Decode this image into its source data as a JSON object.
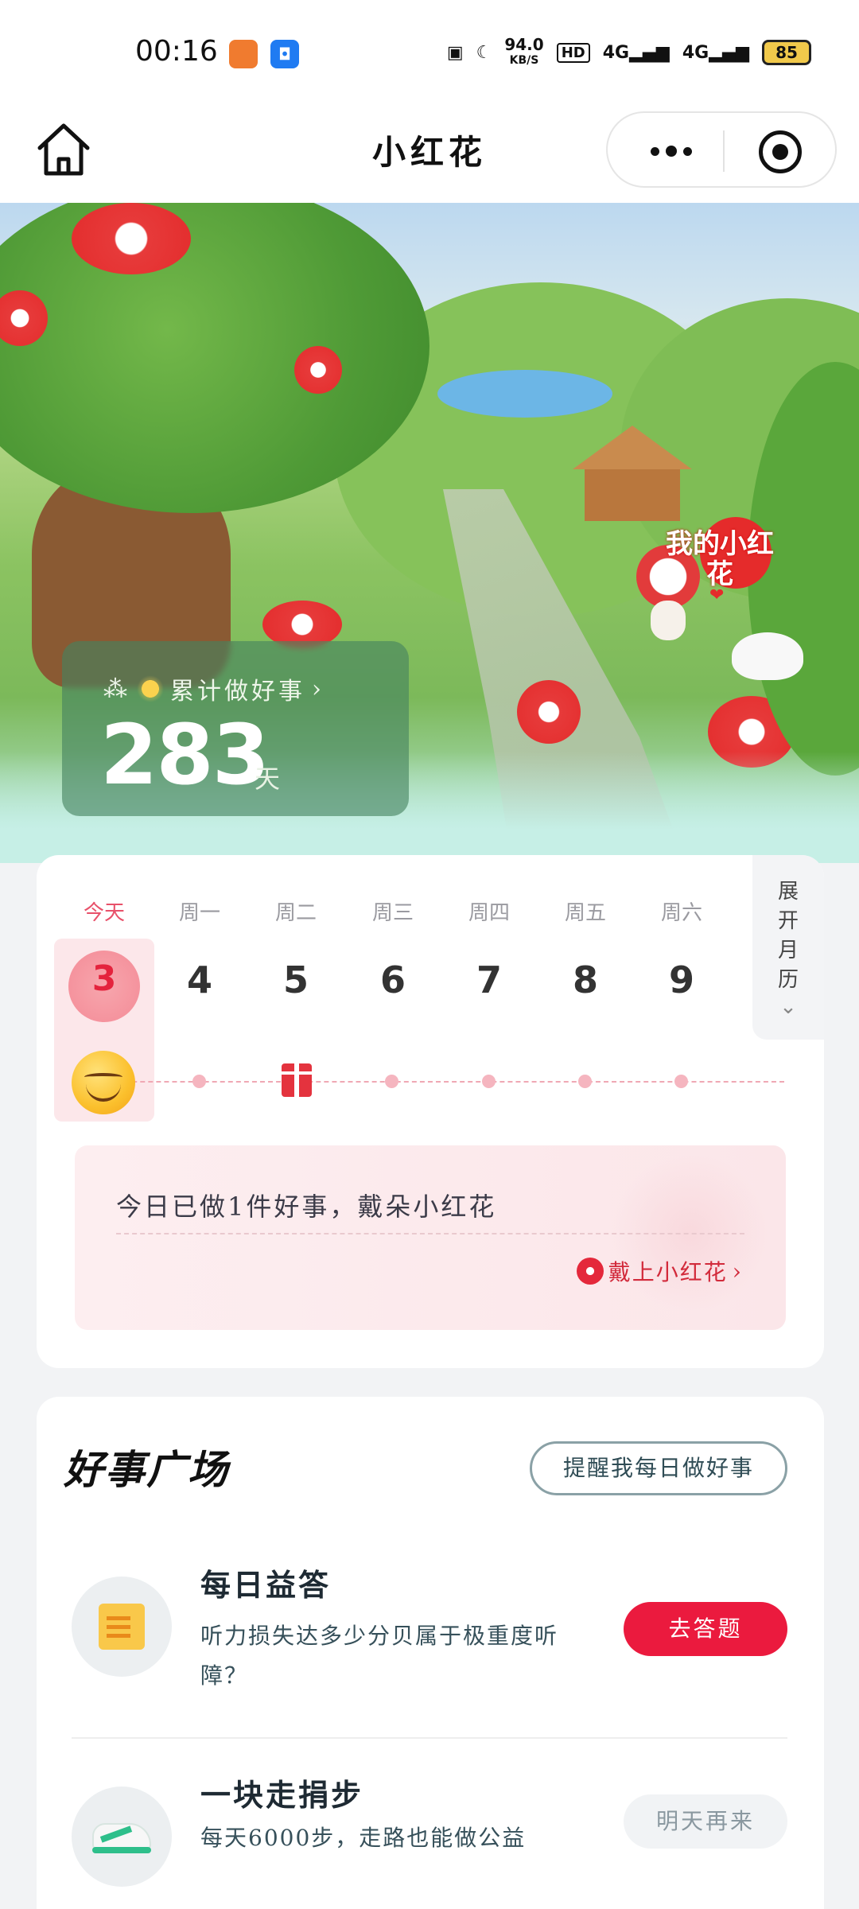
{
  "status_bar": {
    "time": "00:16",
    "speed_value": "94.0",
    "speed_unit": "KB/S",
    "hd_label": "HD",
    "network_1": "4G",
    "network_2": "4G",
    "battery": "85"
  },
  "navbar": {
    "title": "小红花"
  },
  "hero": {
    "stat_label": "累计做好事",
    "stat_value": "283",
    "stat_unit": "天",
    "badge_text": "我的小红花"
  },
  "calendar": {
    "weekdays": [
      "今天",
      "周一",
      "周二",
      "周三",
      "周四",
      "周五",
      "周六"
    ],
    "days": [
      "3",
      "4",
      "5",
      "6",
      "7",
      "8",
      "9"
    ],
    "expand_label": "展开月历",
    "goal_text": "今日已做1件好事，戴朵小红花",
    "goal_link": "戴上小红花"
  },
  "square": {
    "title": "好事广场",
    "remind_button": "提醒我每日做好事",
    "tasks": [
      {
        "title": "每日益答",
        "desc": "听力损失达多少分贝属于极重度听障？",
        "button": "去答题"
      },
      {
        "title": "一块走捐步",
        "desc": "每天6000步，走路也能做公益",
        "button": "明天再来"
      }
    ]
  },
  "colors": {
    "accent_red": "#eb1a3e",
    "today_pink": "#e8516a",
    "link_red": "#d22a3b"
  }
}
